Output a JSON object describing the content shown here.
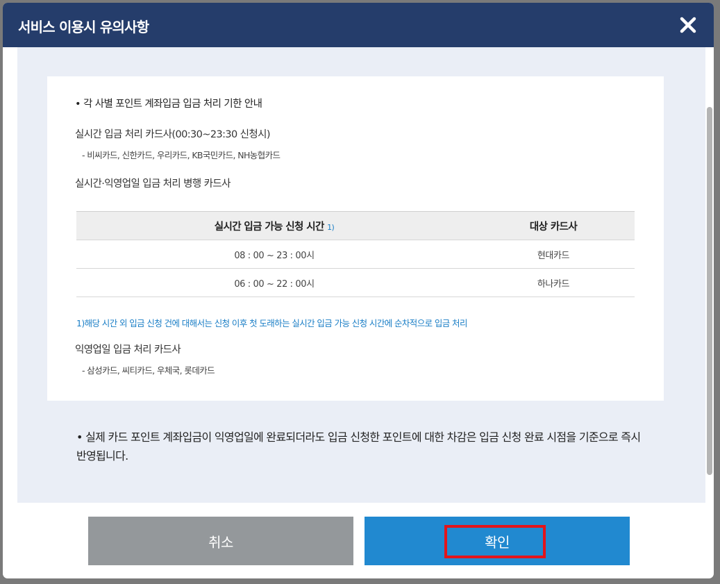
{
  "modal": {
    "title": "서비스 이용시 유의사항",
    "close_icon": "close-icon"
  },
  "content": {
    "section_title": "• 각 사별 포인트 계좌입금 입금 처리 기한 안내",
    "realtime_title": "실시간 입금 처리 카드사(00:30~23:30 신청시)",
    "realtime_cards": "- 비씨카드, 신한카드, 우리카드, KB국민카드, NH농협카드",
    "parallel_title": "실시간·익영업일 입금 처리 병행 카드사",
    "table": {
      "headers": [
        "실시간 입금 가능 신청 시간",
        "대상 카드사"
      ],
      "header_sup": "1)",
      "rows": [
        [
          "08 : 00 ~ 23 : 00시",
          "현대카드"
        ],
        [
          "06 : 00 ~ 22 : 00시",
          "하나카드"
        ]
      ]
    },
    "footnote": "1)해당 시간 외 입금 신청 건에 대해서는 신청 이후 첫 도래하는 실시간 입금 가능 신청 시간에 순차적으로 입금 처리",
    "nextday_title": "익영업일 입금 처리 카드사",
    "nextday_cards": "- 삼성카드, 씨티카드, 우체국, 롯데카드",
    "notice": "• 실제 카드 포인트 계좌입금이 익영업일에 완료되더라도 입금 신청한 포인트에 대한 차감은 입금 신청 완료 시점을 기준으로 즉시 반영됩니다."
  },
  "buttons": {
    "cancel": "취소",
    "confirm": "확인"
  },
  "colors": {
    "header_bg": "#253d6b",
    "body_bg": "#eaeef6",
    "cancel_bg": "#94989b",
    "confirm_bg": "#2189d0",
    "footnote": "#1a7ec6",
    "highlight": "#e3141b"
  }
}
